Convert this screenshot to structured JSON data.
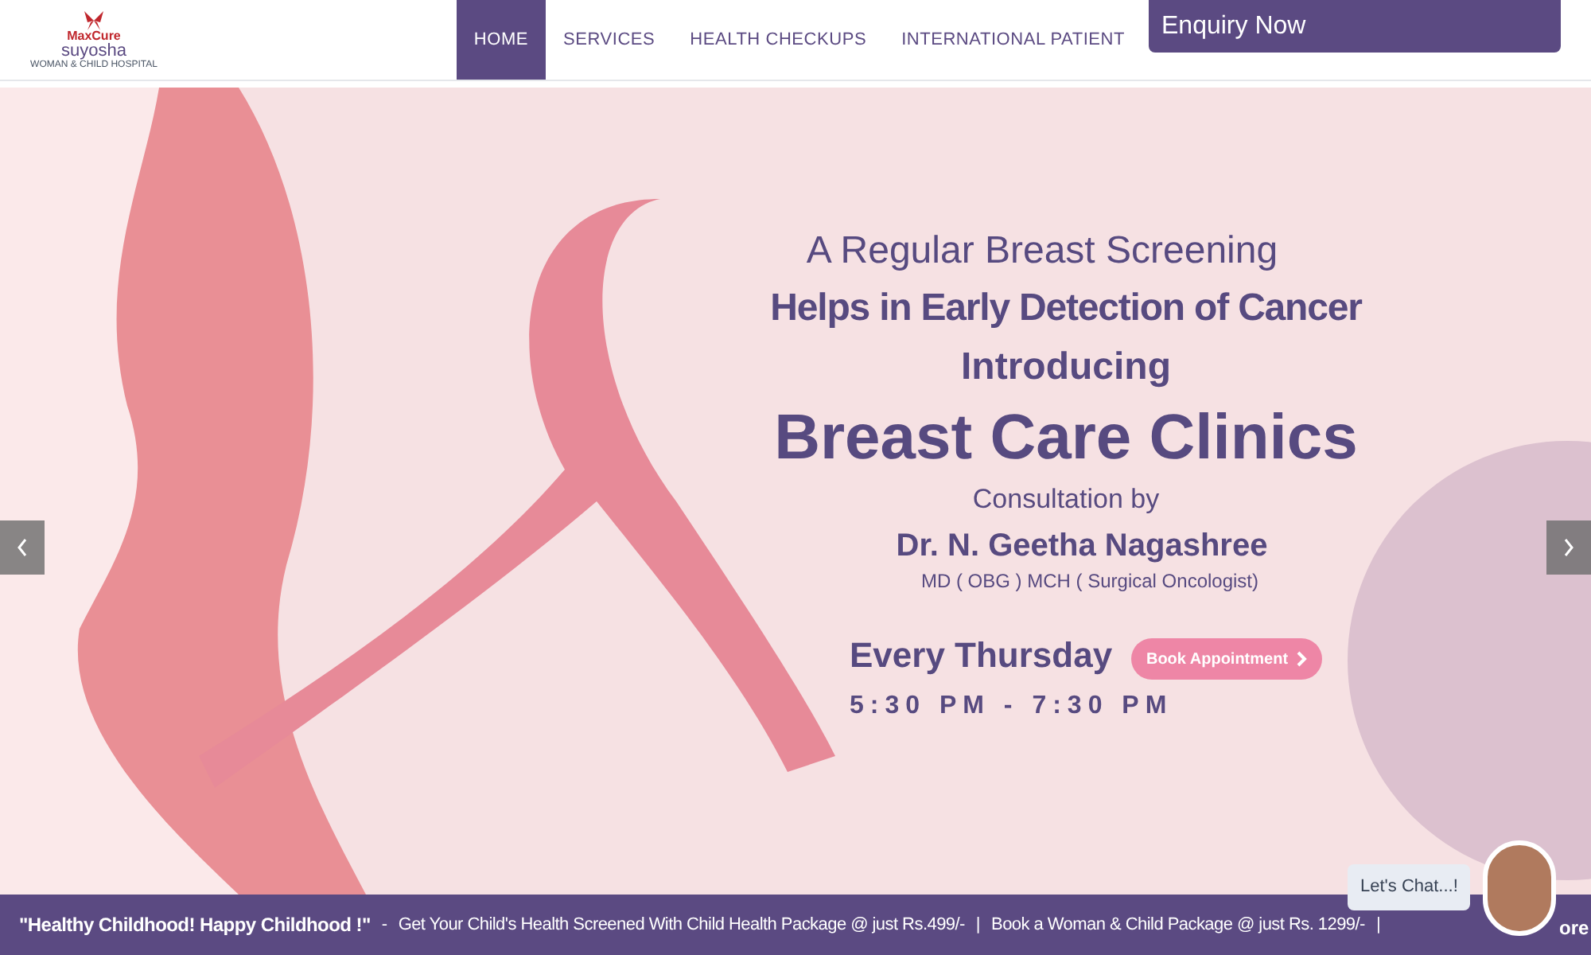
{
  "logo": {
    "brand": "MaxCure",
    "name": "suyosha",
    "tagline": "WOMAN & CHILD HOSPITAL"
  },
  "nav": [
    {
      "label": "HOME",
      "selected": true
    },
    {
      "label": "SERVICES",
      "selected": false
    },
    {
      "label": "HEALTH CHECKUPS",
      "selected": false
    },
    {
      "label": "INTERNATIONAL PATIENT",
      "selected": false
    }
  ],
  "enquiry_button": "Enquiry Now",
  "banner": {
    "line_1": "A Regular Breast Screening",
    "line_2": "Helps in Early Detection of Cancer",
    "line_3": "Introducing",
    "headline": "Breast Care Clinics",
    "consultation": "Consultation by",
    "doctor": "Dr. N. Geetha Nagashree",
    "qualification": "MD ( OBG ) MCH ( Surgical Oncologist)",
    "day": "Every Thursday",
    "time": "5:30 PM - 7:30 PM",
    "book_button": "Book Appointment"
  },
  "ticker": [
    {
      "kind": "title",
      "text": "\"Healthy Childhood! Happy Childhood !\""
    },
    {
      "kind": "separator",
      "text": "-"
    },
    {
      "kind": "item",
      "text": "Get Your Child's Health Screened With Child Health Package @ just Rs.499/-"
    },
    {
      "kind": "separator",
      "text": "|"
    },
    {
      "kind": "item",
      "text": "Book a Woman & Child Package @ just Rs. 1299/-"
    },
    {
      "kind": "separator",
      "text": "|"
    }
  ],
  "ticker_cut": "ore",
  "chat": {
    "label": "Let's Chat...!"
  }
}
